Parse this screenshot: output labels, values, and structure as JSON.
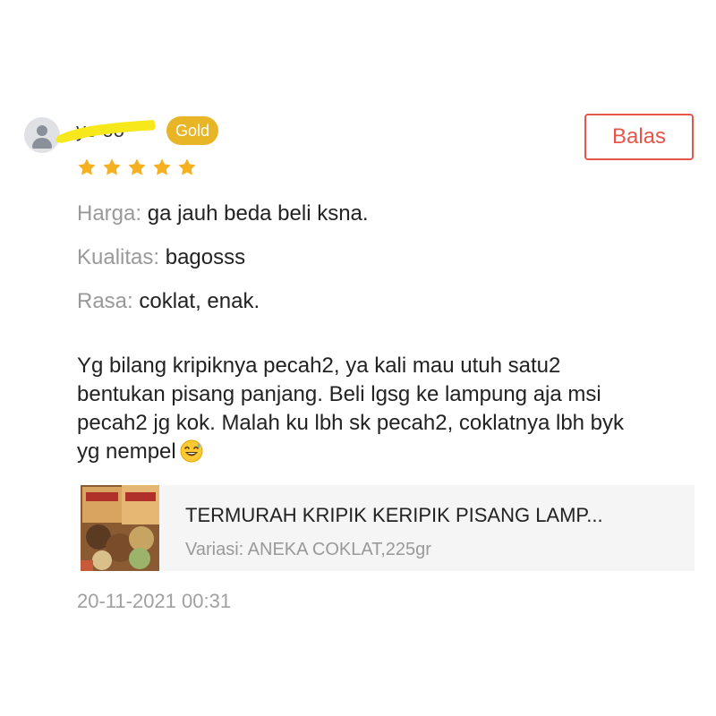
{
  "review": {
    "username": "yo    oo",
    "badge": "Gold",
    "rating": 5,
    "reply_label": "Balas",
    "attributes": [
      {
        "key": "Harga:",
        "value": "ga jauh beda beli ksna."
      },
      {
        "key": "Kualitas:",
        "value": "bagosss"
      },
      {
        "key": "Rasa:",
        "value": "coklat, enak."
      }
    ],
    "comment": {
      "lines": [
        "Yg bilang kripiknya pecah2, ya kali mau utuh satu2",
        "bentukan pisang panjang. Beli lgsg ke lampung aja msi",
        "pecah2 jg kok. Malah ku lbh sk pecah2, coklatnya lbh byk",
        "yg nempel"
      ],
      "emoji": "grinning-sweat-emoji"
    },
    "product": {
      "title": "TERMURAH KRIPIK KERIPIK PISANG LAMP...",
      "variant": "Variasi: ANEKA COKLAT,225gr"
    },
    "timestamp": "20-11-2021 00:31"
  },
  "colors": {
    "accent": "#e4564a",
    "badge": "#e8b526",
    "star": "#f5b021",
    "redaction": "#f7e81c",
    "muted": "#999999"
  }
}
